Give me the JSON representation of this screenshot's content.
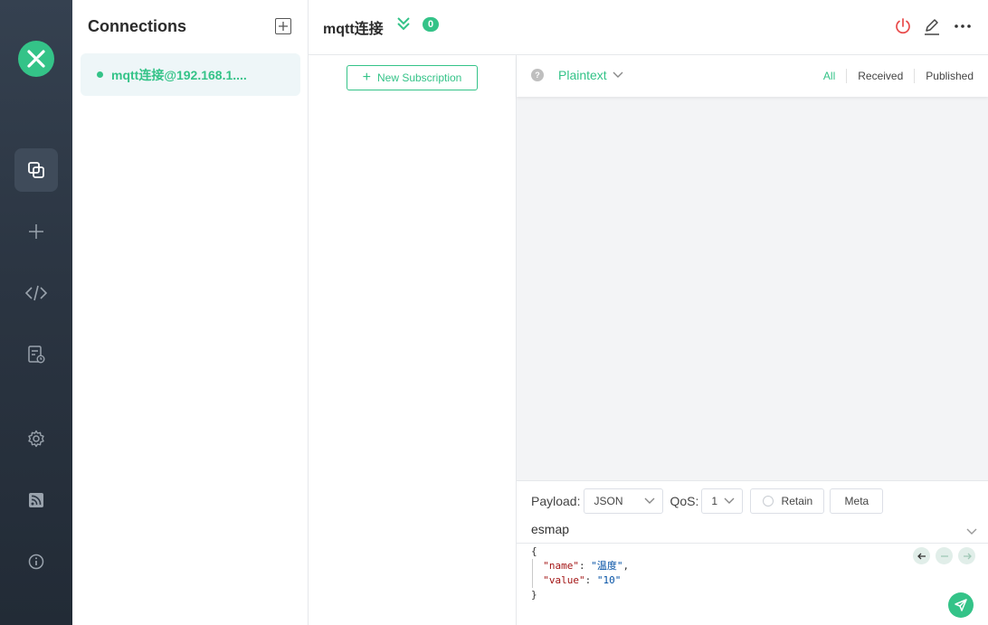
{
  "connections": {
    "title": "Connections",
    "items": [
      {
        "name": "mqtt连接@192.168.1....",
        "status_color": "#34c388"
      }
    ]
  },
  "header": {
    "title": "mqtt连接",
    "unread_count": "0"
  },
  "subscriptions": {
    "new_label": "New Subscription"
  },
  "messages": {
    "format": "Plaintext",
    "filters": [
      "All",
      "Received",
      "Published"
    ],
    "active_filter": "All"
  },
  "publish": {
    "payload_label": "Payload:",
    "payload_format": "JSON",
    "qos_label": "QoS:",
    "qos_value": "1",
    "retain_label": "Retain",
    "meta_label": "Meta",
    "topic": "esmap",
    "payload_lines": {
      "open": "{",
      "name_key": "\"name\"",
      "name_value": "\"温度\"",
      "value_key": "\"value\"",
      "value_value": "\"10\"",
      "close": "}"
    }
  },
  "icons": {
    "logo": "emqx-logo-icon",
    "nav": [
      "connections-icon",
      "add-icon",
      "script-icon",
      "log-icon",
      "settings-icon",
      "rss-icon",
      "info-icon"
    ],
    "header": [
      "disconnect-icon",
      "edit-icon",
      "more-icon"
    ]
  },
  "colors": {
    "accent": "#34c388",
    "danger": "#e84a4a",
    "rail": "#2b3542"
  }
}
